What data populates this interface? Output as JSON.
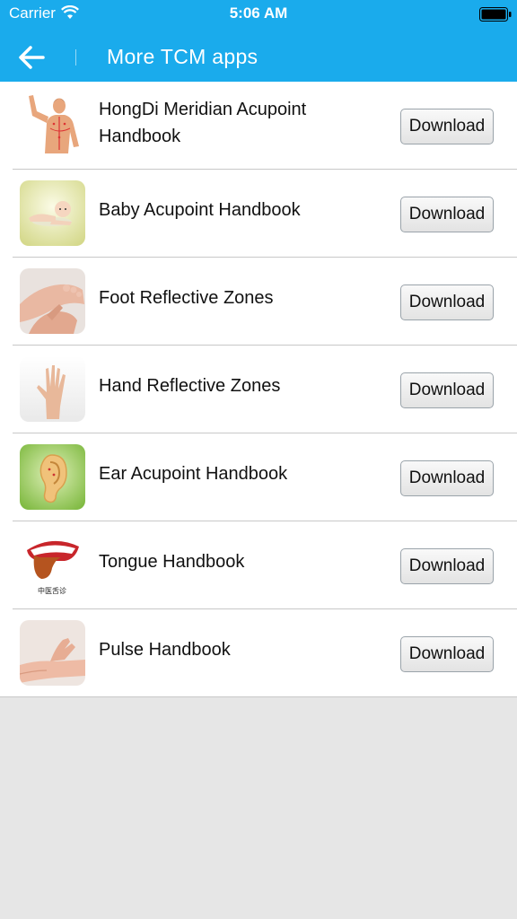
{
  "status_bar": {
    "carrier": "Carrier",
    "time": "5:06 AM",
    "wifi_icon": "wifi-icon",
    "battery_icon": "battery-icon"
  },
  "nav": {
    "title": "More TCM apps",
    "back_icon": "arrow-left-icon"
  },
  "colors": {
    "header": "#1aabec",
    "background": "#e6e6e6"
  },
  "apps": [
    {
      "name": "HongDi Meridian Acupoint Handbook",
      "button": "Download",
      "icon": "meridian-body-icon"
    },
    {
      "name": "Baby Acupoint Handbook",
      "button": "Download",
      "icon": "baby-icon"
    },
    {
      "name": "Foot Reflective Zones",
      "button": "Download",
      "icon": "foot-massage-icon"
    },
    {
      "name": "Hand Reflective Zones",
      "button": "Download",
      "icon": "hand-icon"
    },
    {
      "name": "Ear Acupoint Handbook",
      "button": "Download",
      "icon": "ear-icon"
    },
    {
      "name": "Tongue Handbook",
      "button": "Download",
      "icon": "tongue-icon",
      "icon_caption": "中医舌诊"
    },
    {
      "name": "Pulse Handbook",
      "button": "Download",
      "icon": "pulse-wrist-icon"
    }
  ]
}
